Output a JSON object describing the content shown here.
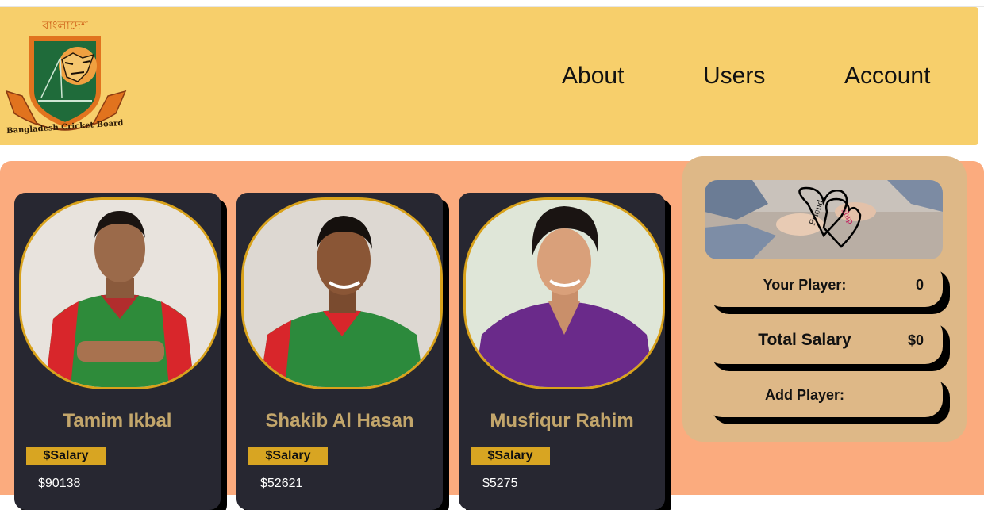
{
  "header": {
    "logo_bengali_text": "বাংলাদেশ",
    "logo_text": "Bangladesh Cricket Board",
    "nav": [
      "About",
      "Users",
      "Account"
    ]
  },
  "players": [
    {
      "name": "Tamim Ikbal",
      "salary_label": "$Salary",
      "salary": "$90138"
    },
    {
      "name": "Shakib Al Hasan",
      "salary_label": "$Salary",
      "salary": "$52621"
    },
    {
      "name": "Musfiqur Rahim",
      "salary_label": "$Salary",
      "salary": "$5275"
    }
  ],
  "summary": {
    "your_player_label": "Your Player:",
    "your_player_value": "0",
    "total_salary_label": "Total Salary",
    "total_salary_value": "$0",
    "add_player_label": "Add Player:",
    "image_text_a": "Friend",
    "image_text_b": "ship"
  },
  "colors": {
    "header_bg": "#f7cf6b",
    "main_bg": "#fbab7e",
    "card_bg": "#272731",
    "gold": "#d8a522",
    "panel_bg": "#deb887"
  }
}
